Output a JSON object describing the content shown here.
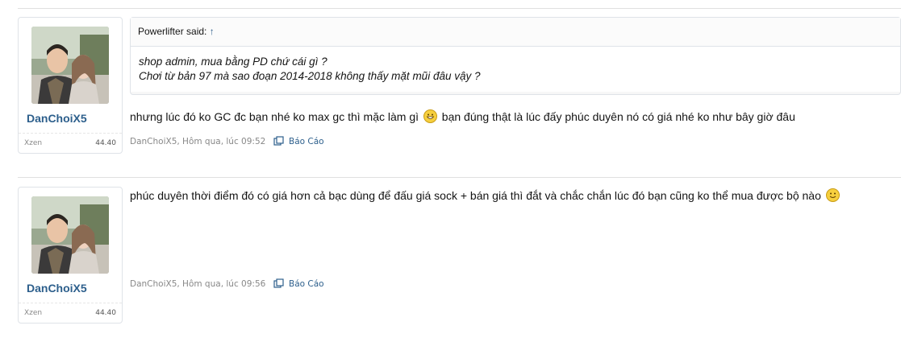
{
  "posts": [
    {
      "user": {
        "name": "DanChoiX5",
        "title": "Xzen",
        "points": "44.40"
      },
      "quote": {
        "attribution": "Powerlifter said:",
        "arrow": "↑",
        "lines": [
          "shop admin, mua bằng PD chứ cái gì ?",
          "Chơi từ bản 97 mà sao đoạn 2014-2018 không thấy mặt mũi đâu vậy ?"
        ]
      },
      "message_before_emoji": "nhưng lúc đó ko GC đc bạn nhé ko max gc thì mặc làm gì",
      "emoji": "grin-icon",
      "message_after_emoji": "bạn đúng thật là lúc đấy phúc duyên nó có giá nhé ko như bây giờ đâu",
      "meta": "DanChoiX5, Hôm qua, lúc 09:52",
      "report": "Báo Cáo"
    },
    {
      "user": {
        "name": "DanChoiX5",
        "title": "Xzen",
        "points": "44.40"
      },
      "message_before_emoji": "phúc duyên thời điểm đó có giá hơn cả bạc dùng để đấu giá sock + bán giá thì đắt và chắc chắn lúc đó bạn cũng ko thể mua được bộ nào",
      "emoji": "smile-icon",
      "meta": "DanChoiX5, Hôm qua, lúc 09:56",
      "report": "Báo Cáo"
    }
  ],
  "colors": {
    "link": "#2d5f8c",
    "meta": "#888888",
    "border": "#dfe3e8"
  }
}
